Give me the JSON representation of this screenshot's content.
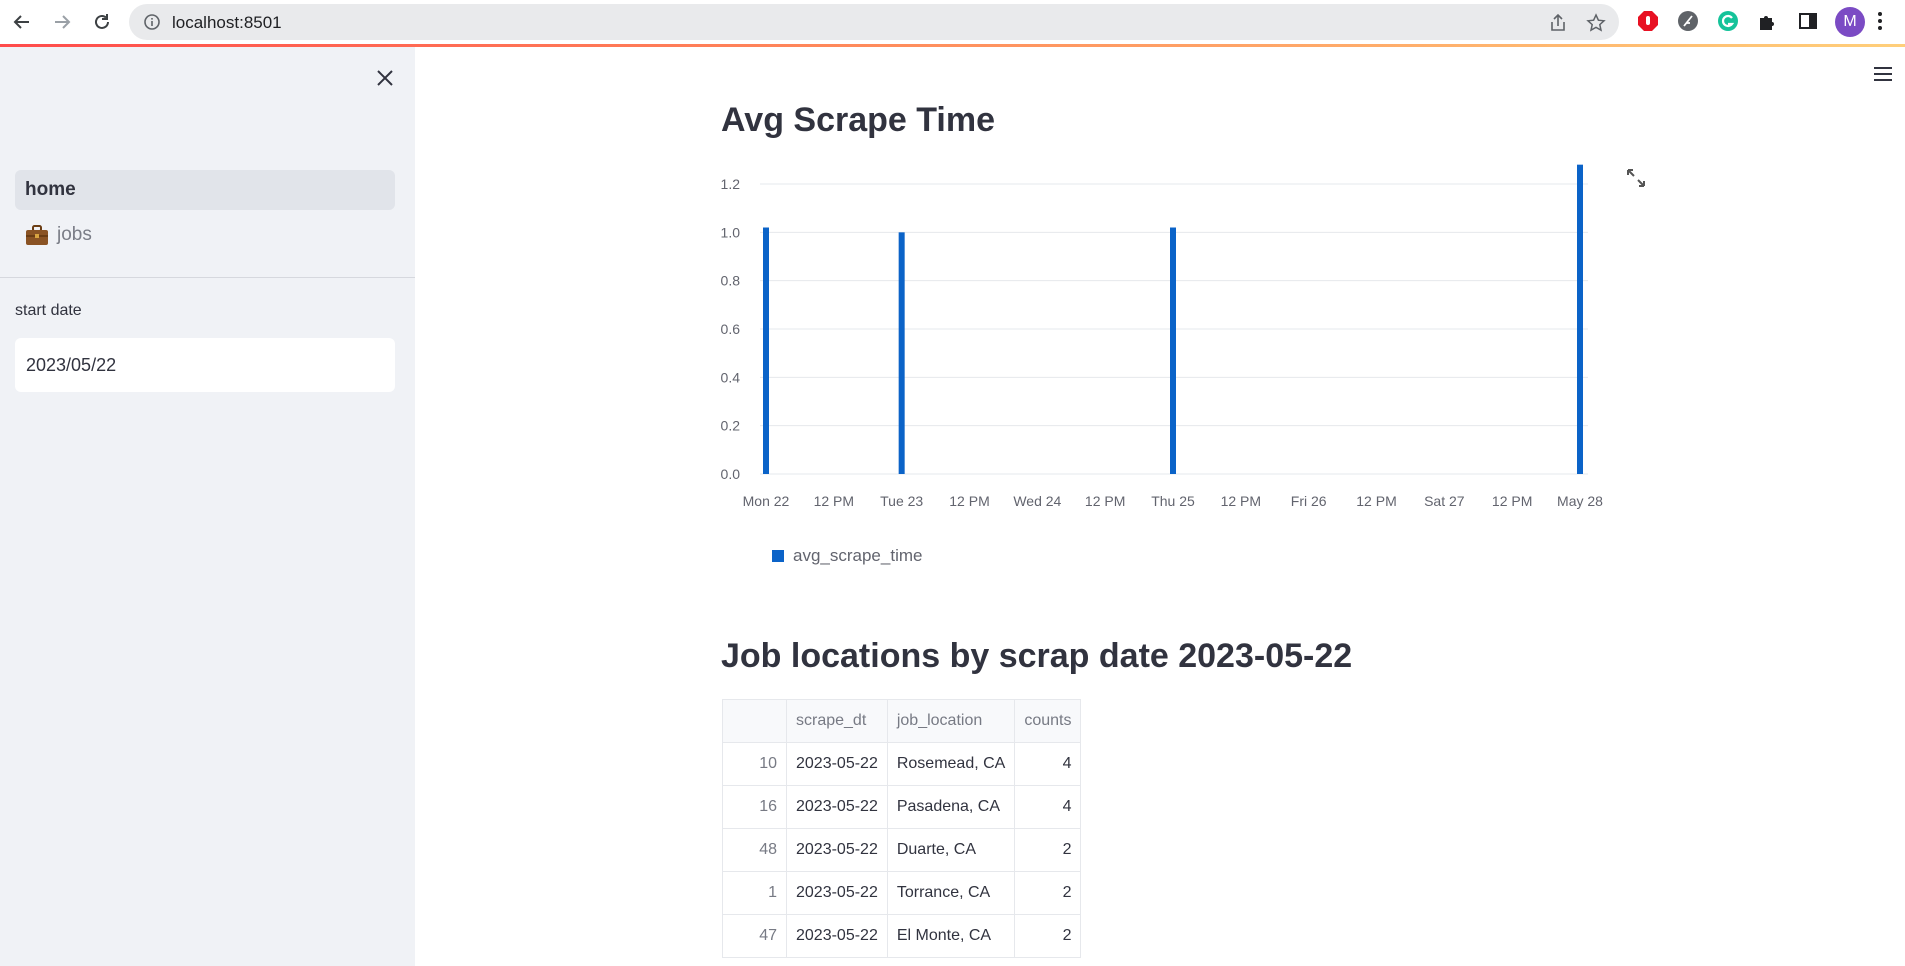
{
  "browser": {
    "url": "localhost:8501",
    "profile_initial": "M",
    "accent_colors": {
      "progress_start": "#ff4b4b",
      "progress_end": "#ffcf7a",
      "avatar": "#7b4bc4"
    }
  },
  "sidebar": {
    "nav_items": [
      {
        "label": "home",
        "icon": ""
      },
      {
        "label": "jobs",
        "icon": "briefcase-icon"
      }
    ],
    "date_label": "start date",
    "date_value": "2023/05/22"
  },
  "main": {
    "chart_title": "Avg Scrape Time",
    "table_title": "Job locations by scrap date 2023-05-22"
  },
  "chart_data": {
    "type": "bar",
    "title": "Avg Scrape Time",
    "xlabel": "",
    "ylabel": "",
    "series": [
      {
        "name": "avg_scrape_time",
        "color": "#0b63c8",
        "points": [
          {
            "x": "2023-05-22",
            "y": 1.02
          },
          {
            "x": "2023-05-23",
            "y": 1.0
          },
          {
            "x": "2023-05-25",
            "y": 1.02
          },
          {
            "x": "2023-05-28",
            "y": 1.28
          }
        ]
      }
    ],
    "y_ticks": [
      "0.0",
      "0.2",
      "0.4",
      "0.6",
      "0.8",
      "1.0",
      "1.2"
    ],
    "x_ticks": [
      "Mon 22",
      "12 PM",
      "Tue 23",
      "12 PM",
      "Wed 24",
      "12 PM",
      "Thu 25",
      "12 PM",
      "Fri 26",
      "12 PM",
      "Sat 27",
      "12 PM",
      "May 28"
    ],
    "ylim": [
      0,
      1.3
    ],
    "grid": true,
    "legend_position": "bottom-left"
  },
  "table": {
    "columns": [
      "",
      "scrape_dt",
      "job_location",
      "counts"
    ],
    "rows": [
      [
        "10",
        "2023-05-22",
        "Rosemead, CA",
        "4"
      ],
      [
        "16",
        "2023-05-22",
        "Pasadena, CA",
        "4"
      ],
      [
        "48",
        "2023-05-22",
        "Duarte, CA",
        "2"
      ],
      [
        "1",
        "2023-05-22",
        "Torrance, CA",
        "2"
      ],
      [
        "47",
        "2023-05-22",
        "El Monte, CA",
        "2"
      ]
    ]
  }
}
